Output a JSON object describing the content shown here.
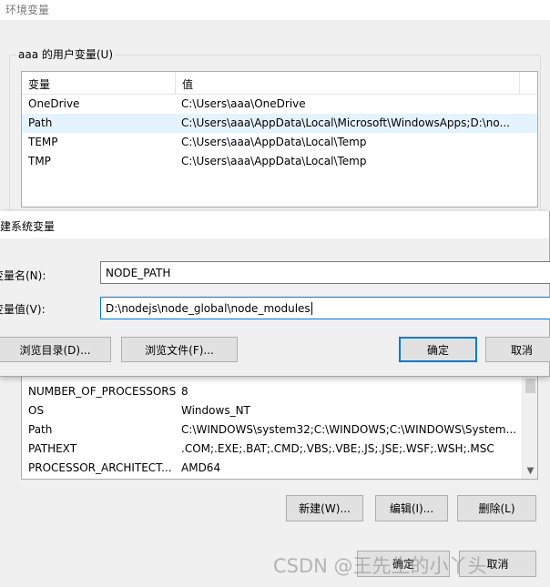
{
  "background_window": {
    "title": "环境变量",
    "user_group_label": "aaa 的用户变量(U)",
    "columns": [
      "变量",
      "值"
    ],
    "user_variables": [
      {
        "name": "OneDrive",
        "value": "C:\\Users\\aaa\\OneDrive"
      },
      {
        "name": "Path",
        "value": "C:\\Users\\aaa\\AppData\\Local\\Microsoft\\WindowsApps;D:\\no..."
      },
      {
        "name": "TEMP",
        "value": "C:\\Users\\aaa\\AppData\\Local\\Temp"
      },
      {
        "name": "TMP",
        "value": "C:\\Users\\aaa\\AppData\\Local\\Temp"
      }
    ],
    "system_variables": [
      {
        "name": "NUMBER_OF_PROCESSORS",
        "value": "8"
      },
      {
        "name": "OS",
        "value": "Windows_NT"
      },
      {
        "name": "Path",
        "value": "C:\\WINDOWS\\system32;C:\\WINDOWS;C:\\WINDOWS\\System..."
      },
      {
        "name": "PATHEXT",
        "value": ".COM;.EXE;.BAT;.CMD;.VBS;.VBE;.JS;.JSE;.WSF;.WSH;.MSC"
      },
      {
        "name": "PROCESSOR_ARCHITECT...",
        "value": "AMD64"
      }
    ],
    "buttons": {
      "new": "新建(W)...",
      "edit": "编辑(I)...",
      "delete": "删除(L)",
      "ok": "确定",
      "cancel": "取消"
    },
    "watermark": "CSDN @王先生的小丫头"
  },
  "dialog": {
    "title": "建系统变量",
    "name_label": "变量名(N):",
    "value_label": "变量值(V):",
    "name_value": "NODE_PATH",
    "value_value": "D:\\nodejs\\node_global\\node_modules",
    "buttons": {
      "browse_dir": "浏览目录(D)...",
      "browse_file": "浏览文件(F)...",
      "ok": "确定",
      "cancel": "取消"
    }
  },
  "colors": {
    "accent": "#0078d7",
    "selected_row": "#e5f3ff"
  }
}
